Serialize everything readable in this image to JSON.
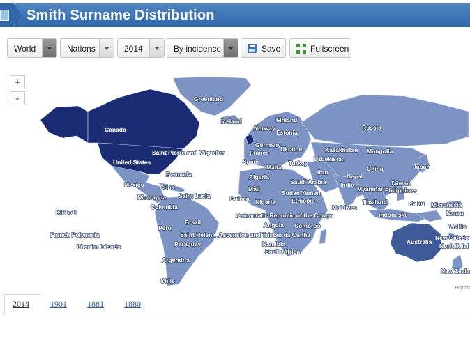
{
  "header": {
    "title": "Smith Surname Distribution"
  },
  "toolbar": {
    "region": "World",
    "level": "Nations",
    "year": "2014",
    "measure": "By incidence",
    "save_label": "Save",
    "fullscreen_label": "Fullscreen"
  },
  "zoom": {
    "in_label": "+",
    "out_label": "-"
  },
  "map": {
    "credit": "Highch",
    "colors": {
      "high": "#1c2c74",
      "mid": "#3f5a99",
      "base": "#7c93c4",
      "light": "#8fa3cf"
    },
    "labels": {
      "greenland": "Greenland",
      "iceland": "Iceland",
      "canada": "Canada",
      "united_states": "United States",
      "saint_pierre": "Saint Pierre and Miquelon",
      "bermuda": "Bermuda",
      "mexico": "Mexico",
      "cuba": "Cuba",
      "nicaragua": "Nicaragua",
      "saint_lucia": "Saint Lucia",
      "colombia": "Colombia",
      "kiribati": "Kiribati",
      "french_polynesia": "French Polynesia",
      "pitcairn": "Pitcairn Islands",
      "peru": "Peru",
      "brazil": "Brazil",
      "paraguay": "Paraguay",
      "argentina": "Argentina",
      "chile": "Chile",
      "saint_helena": "Saint Helena, Ascension and Tristan da Cunha",
      "finland": "Finland",
      "norway": "Norway",
      "estonia": "Estonia",
      "germany": "Germany",
      "france": "France",
      "spain": "Spain",
      "malta": "Malta",
      "ukraine": "Ukraine",
      "turkey": "Turkey",
      "algeria": "Algeria",
      "mali": "Mali",
      "guinea": "Guinea",
      "nigeria": "Nigeria",
      "sudan": "Sudan",
      "yemen": "Yemen",
      "ethiopia": "Ethiopia",
      "drc": "Democratic Republic of the Congo",
      "angola": "Angola",
      "comoros": "Comoros",
      "namibia": "Namibia",
      "south_africa": "South Africa",
      "saudi_arabia": "Saudi Arabia",
      "iran": "Iran",
      "russia": "Russia",
      "kazakhstan": "Kazakhstan",
      "uzbekistan": "Uzbekistan",
      "mongolia": "Mongolia",
      "china": "China",
      "nepal": "Nepal",
      "india": "India",
      "myanmar": "Myanmar",
      "thailand": "Thailand",
      "maldives": "Maldives",
      "japan": "Japan",
      "taiwan": "Taiwan",
      "philippines": "Philippines",
      "palau": "Palau",
      "micronesia": "Micronesia",
      "nauru": "Nauru",
      "indonesia": "Indonesia",
      "wallis": "Wallis",
      "new_caledonia": "New Caledon",
      "norfolk": "Norfolk Isl",
      "australia": "Australia",
      "new_zealand": "New Zeala"
    }
  },
  "tabs": [
    "2014",
    "1901",
    "1881",
    "1880"
  ]
}
